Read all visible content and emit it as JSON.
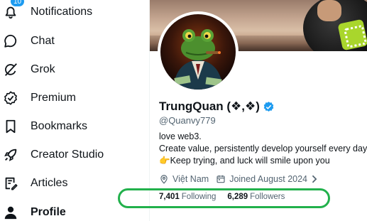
{
  "sidebar": {
    "items": [
      {
        "label": "Notifications",
        "icon": "bell-icon",
        "badge": "10"
      },
      {
        "label": "Chat",
        "icon": "chat-bubble-icon"
      },
      {
        "label": "Grok",
        "icon": "grok-icon"
      },
      {
        "label": "Premium",
        "icon": "verified-badge-icon"
      },
      {
        "label": "Bookmarks",
        "icon": "bookmark-icon"
      },
      {
        "label": "Creator Studio",
        "icon": "rocket-icon"
      },
      {
        "label": "Articles",
        "icon": "article-edit-icon"
      },
      {
        "label": "Profile",
        "icon": "person-icon"
      }
    ]
  },
  "profile": {
    "display_name": "TrungQuan (❖,❖)",
    "handle": "@Quanvy779",
    "bio": [
      "love web3.",
      "Create value, persistently develop yourself every day",
      "👉Keep trying, and luck will smile upon you"
    ],
    "location": "Việt Nam",
    "joined": "Joined August 2024",
    "following_count": "7,401",
    "following_label": "Following",
    "followers_count": "6,289",
    "followers_label": "Followers"
  },
  "colors": {
    "accent": "#1d9bf0",
    "highlight": "#22b14c",
    "secondary_text": "#536471"
  }
}
